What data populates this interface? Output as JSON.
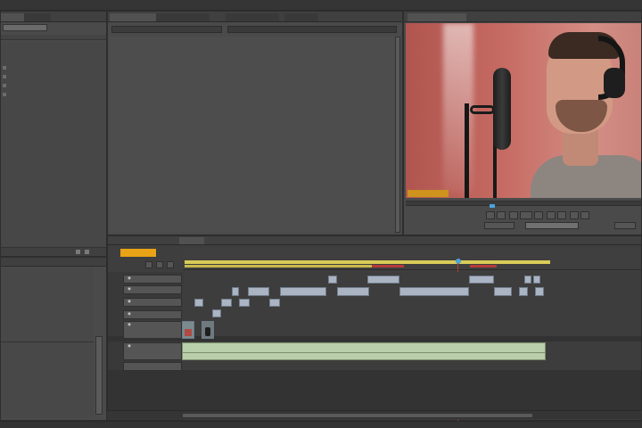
{
  "project_panel": {
    "tabs": [
      {
        "label": ""
      },
      {
        "label": ""
      }
    ],
    "search_placeholder": "",
    "items": [
      {
        "label": ""
      },
      {
        "label": ""
      },
      {
        "label": ""
      },
      {
        "label": ""
      }
    ]
  },
  "source_monitor": {
    "tabs": [
      {
        "label": ""
      },
      {
        "label": ""
      },
      {
        "label": ""
      },
      {
        "label": ""
      }
    ],
    "dropdown_value": ""
  },
  "program_monitor": {
    "tab_label": "",
    "timecode": "",
    "duration": ""
  },
  "effects_panel": {
    "items": [
      {
        "label": ""
      },
      {
        "label": ""
      },
      {
        "label": ""
      },
      {
        "label": ""
      }
    ]
  },
  "timeline": {
    "tab_label": "",
    "timecode": "",
    "ruler_labels": [
      "",
      "",
      "",
      "",
      "",
      "",
      "",
      "",
      "",
      ""
    ],
    "video_tracks": [
      {
        "name": ""
      },
      {
        "name": ""
      },
      {
        "name": ""
      },
      {
        "name": ""
      }
    ],
    "audio_tracks": [
      {
        "name": ""
      },
      {
        "name": ""
      },
      {
        "name": ""
      }
    ],
    "clips": [
      {
        "track": "V3",
        "label": ""
      },
      {
        "track": "V3",
        "label": ""
      },
      {
        "track": "V3",
        "label": ""
      },
      {
        "track": "V3",
        "label": ""
      },
      {
        "track": "V2",
        "label": ""
      },
      {
        "track": "V2",
        "label": ""
      },
      {
        "track": "V2",
        "label": ""
      },
      {
        "track": "V2",
        "label": ""
      },
      {
        "track": "V2",
        "label": ""
      },
      {
        "track": "V2",
        "label": ""
      },
      {
        "track": "V2",
        "label": ""
      },
      {
        "track": "V2",
        "label": ""
      },
      {
        "track": "V1",
        "label": ""
      },
      {
        "track": "V1",
        "label": ""
      },
      {
        "track": "V1",
        "label": ""
      },
      {
        "track": "A1",
        "label": ""
      }
    ]
  },
  "colors": {
    "accent_timecode": "#e8a317",
    "playhead": "#c0392b",
    "video_clip": "#aab4c2",
    "audio_clip": "#b9ceaa",
    "work_area": "#d9cc57"
  }
}
